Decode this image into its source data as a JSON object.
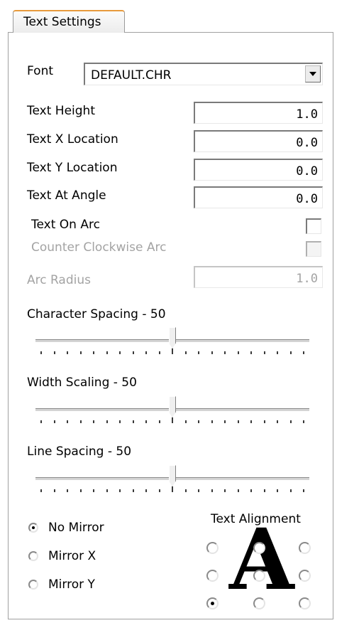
{
  "tab": {
    "title": "Text Settings"
  },
  "font": {
    "label": "Font",
    "value": "DEFAULT.CHR"
  },
  "fields": [
    {
      "label": "Text Height",
      "value": "1.0",
      "enabled": true
    },
    {
      "label": "Text X Location",
      "value": "0.0",
      "enabled": true
    },
    {
      "label": "Text Y Location",
      "value": "0.0",
      "enabled": true
    },
    {
      "label": "Text At Angle",
      "value": "0.0",
      "enabled": true
    }
  ],
  "text_on_arc": {
    "label": "Text On Arc",
    "checked": false,
    "enabled": true
  },
  "counter_clockwise_arc": {
    "label": "Counter Clockwise Arc",
    "checked": false,
    "enabled": false
  },
  "arc_radius": {
    "label": "Arc Radius",
    "value": "1.0",
    "enabled": false
  },
  "sliders": [
    {
      "label": "Character Spacing - 50",
      "value": 50,
      "max": 100
    },
    {
      "label": "Width Scaling - 50",
      "value": 50,
      "max": 100
    },
    {
      "label": "Line Spacing - 50",
      "value": 50,
      "max": 100
    }
  ],
  "mirror": {
    "options": [
      "No Mirror",
      "Mirror X",
      "Mirror Y"
    ],
    "selected": "No Mirror"
  },
  "alignment": {
    "label": "Text Alignment",
    "glyph": "A",
    "selected": "bottom-left"
  }
}
